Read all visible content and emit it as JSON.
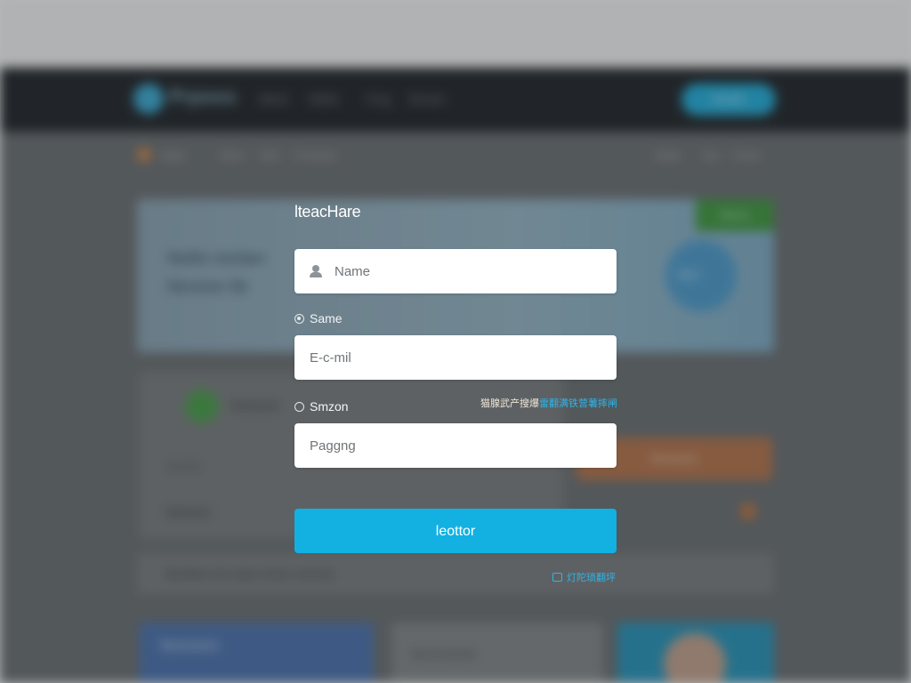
{
  "background": {
    "brand": "Prpoos",
    "nav_links": [
      "Mnnir",
      "Mnfer",
      "Forg",
      "Nrrnen"
    ],
    "nav_button": "Nnsifn",
    "breadcrumb": [
      "Ntrpk",
      "Mnnr",
      "Nnfr",
      "Frrnenen"
    ],
    "breadcrumb_right": [
      "Mnfer",
      "Nrn",
      "Fomir"
    ],
    "hero_lines": [
      "Nnihi nnriien",
      "Nrnmm fiir"
    ],
    "hero_badge": "Nrmrn",
    "bubble_label": "Mnrr",
    "card_title": "Nnnrnnn",
    "card_sub": "Nnrnfrf",
    "card_bottom": "Mrnmnr",
    "orange_button": "Nrnnnnrn",
    "strip_text": "Mrrnfnm nrn nnen rrnnnr nnrnrnn",
    "bottom_card1": "Nnrnnnrn",
    "bottom_card2": "Nnrnrnmnnfr"
  },
  "form": {
    "title": "lteacHare",
    "name_placeholder": "Name",
    "radio1_label": "Same",
    "email_placeholder": "E-c-mil",
    "radio2_label": "Smzon",
    "side_link_prefix": "猫腺武产搜爆",
    "side_link_highlight": "雷翻满铁营薯摔闸",
    "password_placeholder": "Paggng",
    "submit_label": "leottor",
    "help_link": "灯陀琐翻坪"
  },
  "icons": {
    "name_field": "user-icon",
    "help_link": "message-icon"
  },
  "colors": {
    "nav_bg": "#1e2327",
    "accent": "#12b1e2",
    "link": "#2cb6ea",
    "field_bg": "#ffffff"
  }
}
